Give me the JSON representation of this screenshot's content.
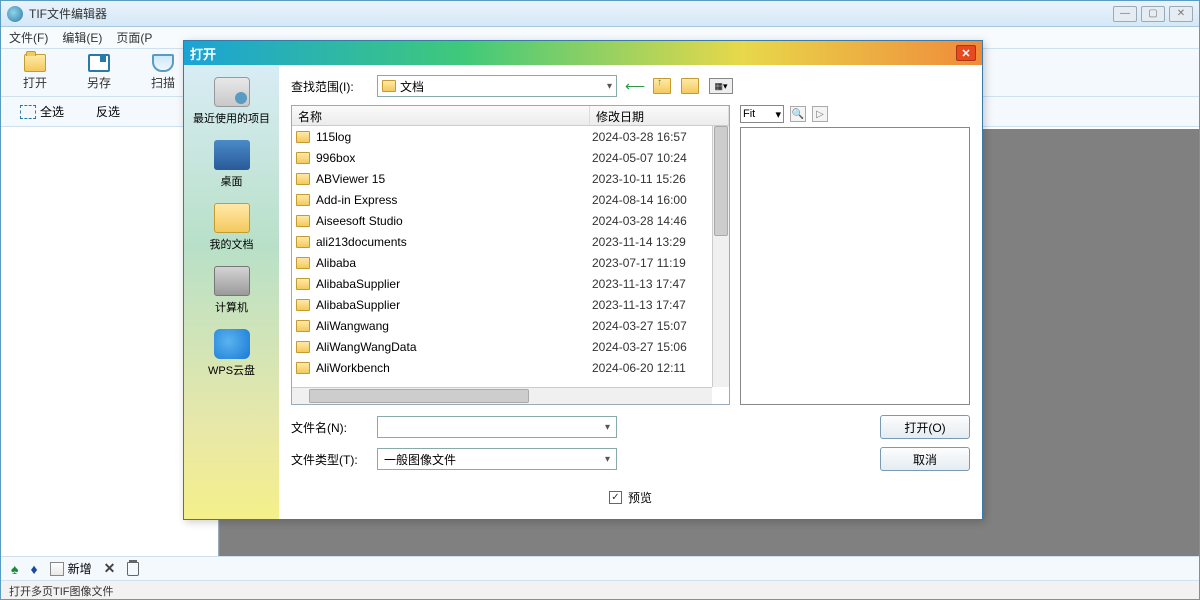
{
  "main": {
    "title": "TIF文件编辑器",
    "menu": [
      "文件(F)",
      "编辑(E)",
      "页面(P"
    ],
    "toolbar": {
      "open": "打开",
      "save": "另存",
      "scan": "扫描"
    },
    "toolbar2": {
      "select_all": "全选",
      "invert": "反选"
    },
    "bottom": {
      "new": "新增"
    },
    "status": "打开多页TIF图像文件"
  },
  "dialog": {
    "title": "打开",
    "look_in_label": "查找范围(I):",
    "look_in_value": "文档",
    "sidebar": [
      {
        "label": "最近使用的项目",
        "cls": "sb-recent"
      },
      {
        "label": "桌面",
        "cls": "sb-desktop"
      },
      {
        "label": "我的文档",
        "cls": "sb-docs"
      },
      {
        "label": "计算机",
        "cls": "sb-computer"
      },
      {
        "label": "WPS云盘",
        "cls": "sb-wps"
      }
    ],
    "columns": {
      "name": "名称",
      "date": "修改日期"
    },
    "files": [
      {
        "name": "115log",
        "date": "2024-03-28 16:57"
      },
      {
        "name": "996box",
        "date": "2024-05-07 10:24"
      },
      {
        "name": "ABViewer 15",
        "date": "2023-10-11 15:26"
      },
      {
        "name": "Add-in Express",
        "date": "2024-08-14 16:00"
      },
      {
        "name": "Aiseesoft Studio",
        "date": "2024-03-28 14:46"
      },
      {
        "name": "ali213documents",
        "date": "2023-11-14 13:29"
      },
      {
        "name": "Alibaba",
        "date": "2023-07-17 11:19"
      },
      {
        "name": "AlibabaSupplier",
        "date": "2023-11-13 17:47"
      },
      {
        "name": "AlibabaSupplier",
        "date": "2023-11-13 17:47"
      },
      {
        "name": "AliWangwang",
        "date": "2024-03-27 15:07"
      },
      {
        "name": "AliWangWangData",
        "date": "2024-03-27 15:06"
      },
      {
        "name": "AliWorkbench",
        "date": "2024-06-20 12:11"
      }
    ],
    "filename_label": "文件名(N):",
    "filename_value": "",
    "filetype_label": "文件类型(T):",
    "filetype_value": "一般图像文件",
    "open_btn": "打开(O)",
    "cancel_btn": "取消",
    "preview_chk": "预览",
    "fit": "Fit"
  }
}
